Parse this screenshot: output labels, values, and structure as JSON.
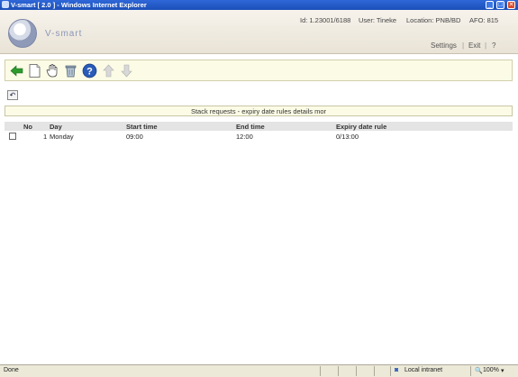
{
  "window": {
    "title": "V-smart [ 2.0 ] - Windows Internet Explorer",
    "min": "_",
    "max": "□",
    "close": "✕"
  },
  "header": {
    "logo_text": "V-smart",
    "id_text": "Id: 1.23001/6188",
    "user_text": "User: Tineke",
    "location_text": "Location: PNB/BD",
    "afo_text": "AFO: 815",
    "nav": {
      "settings": "Settings",
      "exit": "Exit",
      "help": "?"
    }
  },
  "toolbar": {
    "icons": [
      "back-arrow-icon",
      "new-document-icon",
      "select-hand-icon",
      "delete-bin-icon",
      "help-icon",
      "move-up-icon",
      "move-down-icon"
    ]
  },
  "undo_glyph": "↶",
  "page_heading": "Stack requests - expiry date rules details mor",
  "table": {
    "headers": {
      "no": "No",
      "day": "Day",
      "start": "Start time",
      "end": "End time",
      "rule": "Expiry date rule"
    },
    "rows": [
      {
        "no": "1",
        "day": "Monday",
        "start": "09:00",
        "end": "12:00",
        "rule": "0/13:00"
      }
    ]
  },
  "statusbar": {
    "left": "Done",
    "zone": "Local intranet",
    "zoom": "100%"
  },
  "colors": {
    "accent_green": "#2e9a2e",
    "toolbar_bg": "#fbfbe6",
    "titlebar_blue": "#1b4fb8"
  }
}
